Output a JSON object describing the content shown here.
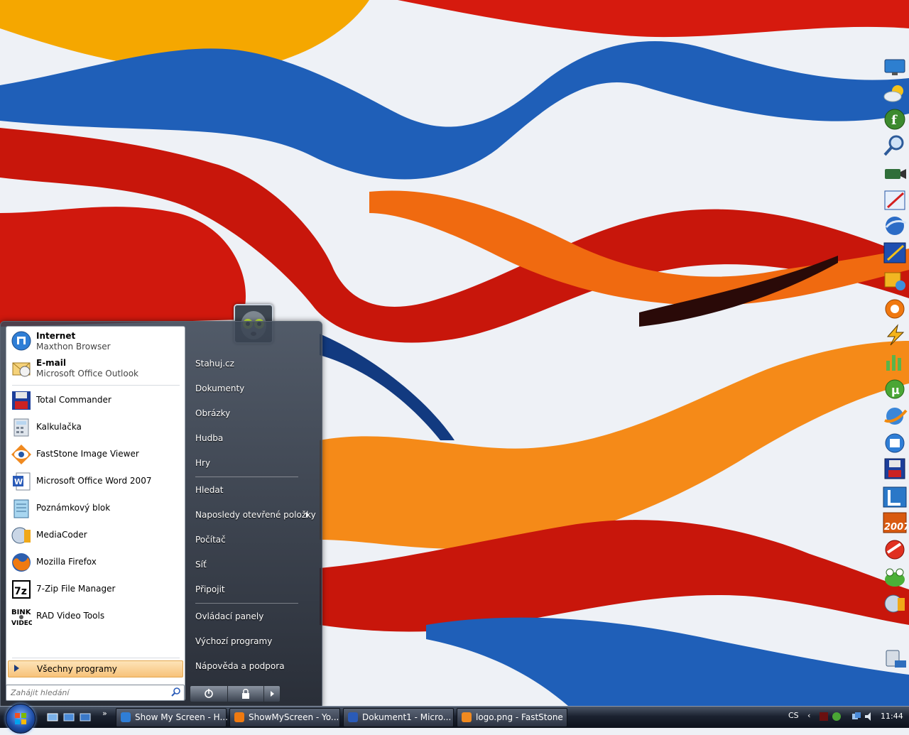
{
  "start_menu": {
    "pinned": [
      {
        "title": "Internet",
        "subtitle": "Maxthon Browser",
        "icon": "maxthon-icon"
      },
      {
        "title": "E-mail",
        "subtitle": "Microsoft Office Outlook",
        "icon": "outlook-icon"
      }
    ],
    "programs": [
      {
        "label": "Total Commander",
        "icon": "floppy-disk-icon"
      },
      {
        "label": "Kalkulačka",
        "icon": "calculator-icon"
      },
      {
        "label": "FastStone Image Viewer",
        "icon": "eye-icon"
      },
      {
        "label": "Microsoft Office Word 2007",
        "icon": "word-icon"
      },
      {
        "label": "Poznámkový blok",
        "icon": "notepad-icon"
      },
      {
        "label": "MediaCoder",
        "icon": "mediacoder-icon"
      },
      {
        "label": "Mozilla Firefox",
        "icon": "firefox-icon"
      },
      {
        "label": "7-Zip File Manager",
        "icon": "7zip-icon"
      },
      {
        "label": "RAD Video Tools",
        "icon": "bink-video-icon"
      }
    ],
    "all_programs": "Všechny programy",
    "search_placeholder": "Zahájit hledání",
    "right_items": [
      "Stahuj.cz",
      "Dokumenty",
      "Obrázky",
      "Hudba",
      "Hry",
      "Hledat",
      "Naposledy otevřené položky",
      "Počítač",
      "Síť",
      "Připojit",
      "Ovládací panely",
      "Výchozí programy",
      "Nápověda a podpora"
    ]
  },
  "taskbar": {
    "buttons": [
      {
        "label": "Show My Screen - H...",
        "icon": "maxthon-icon"
      },
      {
        "label": "ShowMyScreen - Yo...",
        "icon": "firefox-icon"
      },
      {
        "label": "Dokument1 - Micro...",
        "icon": "word-icon"
      },
      {
        "label": "logo.png - FastStone",
        "icon": "faststone-icon"
      }
    ],
    "language": "CS",
    "clock": "11:44"
  },
  "colors": {
    "accent_orange": "#f7c27a",
    "taskbar_dark": "#1b2230"
  }
}
